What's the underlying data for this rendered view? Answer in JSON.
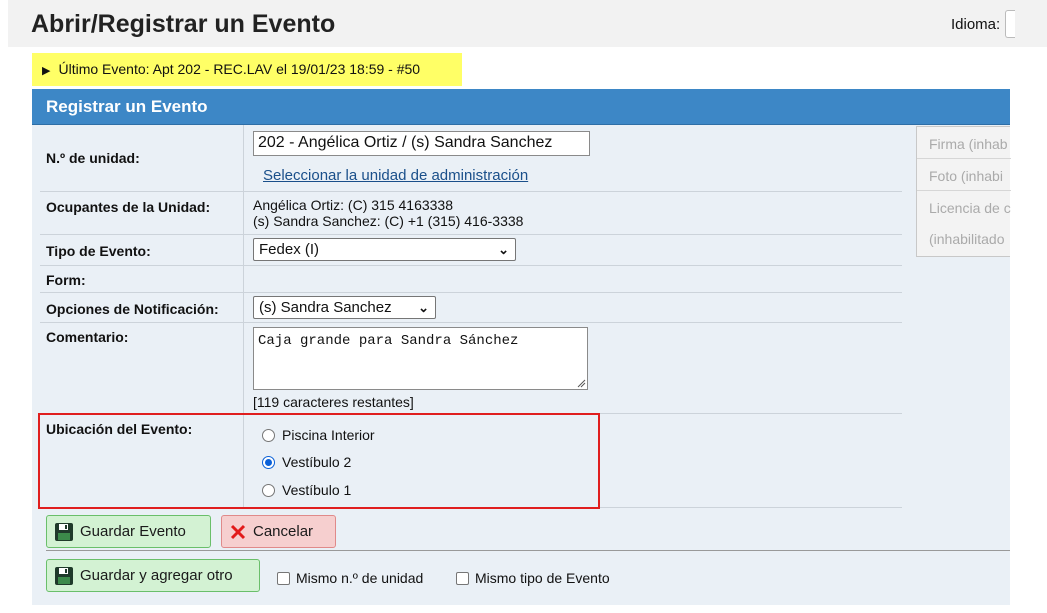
{
  "header": {
    "title": "Abrir/Registrar un Evento",
    "language_label": "Idioma:"
  },
  "last_event": {
    "text": "Último Evento: Apt 202 - REC.LAV el 19/01/23 18:59 - #50"
  },
  "panel": {
    "title": "Registrar un Evento"
  },
  "form": {
    "unit": {
      "label": "N.º de unidad:",
      "value": "202 - Angélica Ortiz / (s) Sandra Sanchez",
      "link": "Seleccionar la unidad de administración"
    },
    "occupants": {
      "label": "Ocupantes de la Unidad:",
      "lines": [
        "Angélica Ortiz: (C) 315 4163338",
        "(s) Sandra Sanchez: (C) +1 (315) 416-3338"
      ]
    },
    "event_type": {
      "label": "Tipo de Evento:",
      "selected": "Fedex (I)"
    },
    "form_field": {
      "label": "Form:"
    },
    "notification": {
      "label": "Opciones de Notificación:",
      "selected": "(s) Sandra Sanchez"
    },
    "comment": {
      "label": "Comentario:",
      "value": "Caja grande para Sandra Sánchez",
      "remaining": "[119 caracteres restantes]"
    },
    "location": {
      "label": "Ubicación del Evento:",
      "options": [
        {
          "label": "Piscina Interior",
          "checked": false
        },
        {
          "label": "Vestíbulo 2",
          "checked": true
        },
        {
          "label": "Vestíbulo 1",
          "checked": false
        }
      ]
    }
  },
  "side": {
    "signature": "Firma (inhab",
    "photo": "Foto (inhabi",
    "license_line1": "Licencia de c",
    "license_line2": "(inhabilitado"
  },
  "buttons": {
    "save": "Guardar Evento",
    "cancel": "Cancelar",
    "save_add": "Guardar y agregar otro"
  },
  "checkboxes": {
    "same_unit": "Mismo n.º de unidad",
    "same_type": "Mismo tipo de Evento"
  },
  "colors": {
    "header_blue": "#3d87c6",
    "highlight_yellow": "#ffff66",
    "annotation_red": "#e01e1e",
    "panel_bg": "#eaf0f6"
  }
}
